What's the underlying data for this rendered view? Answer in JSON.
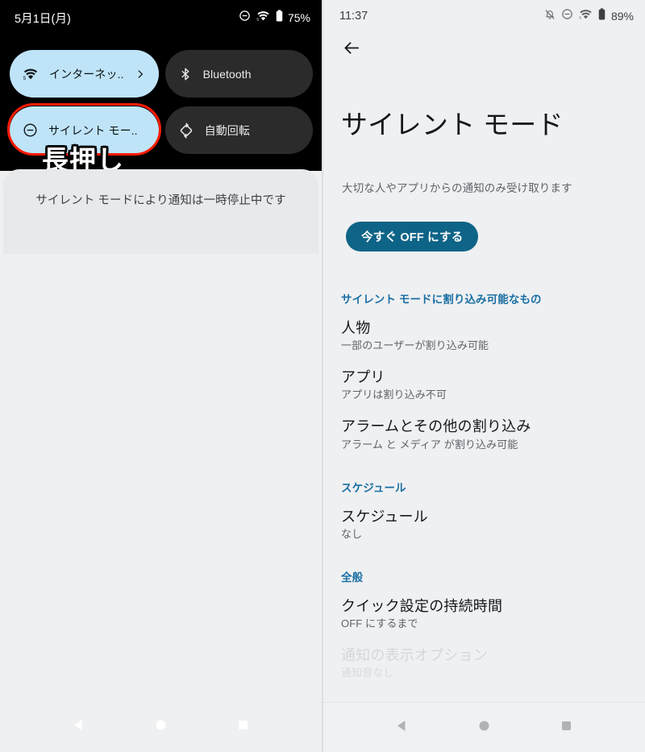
{
  "left_panel": {
    "status_bar": {
      "date": "5月1日(月)",
      "icons": [
        "dnd-circle-minus-icon",
        "wifi-icon",
        "battery-icon"
      ],
      "battery_percent": "75%"
    },
    "quick_tiles": [
      {
        "label": "インターネッ..",
        "icon": "wifi-icon",
        "state": "on",
        "chevron": "chevron-right-icon"
      },
      {
        "label": "Bluetooth",
        "icon": "bluetooth-icon",
        "state": "off",
        "chevron": ""
      },
      {
        "label": "サイレント モー..",
        "icon": "dnd-circle-minus-icon",
        "state": "on",
        "chevron": ""
      },
      {
        "label": "自動回転",
        "icon": "auto-rotate-icon",
        "state": "off",
        "chevron": ""
      }
    ],
    "annotation": {
      "text": "長押し",
      "highlight_color": "#ff1a00"
    },
    "notification_shade": {
      "message": "サイレント モードにより通知は一時停止中です"
    },
    "nav_bar": {
      "back": "back-triangle-icon",
      "home": "home-circle-icon",
      "recents": "recents-square-icon"
    }
  },
  "right_panel": {
    "status_bar": {
      "time": "11:37",
      "icons": [
        "bell-muted-icon",
        "dnd-circle-minus-icon",
        "wifi-icon",
        "battery-icon"
      ],
      "battery_percent": "89%"
    },
    "back_button": "back-arrow-icon",
    "title": "サイレント モード",
    "subtitle": "大切な人やアプリからの通知のみ受け取ります",
    "primary_action": {
      "label": "今すぐ OFF にする",
      "color": "#0e6487"
    },
    "sections": [
      {
        "header": "サイレント モードに割り込み可能なもの",
        "items": [
          {
            "title": "人物",
            "summary": "一部のユーザーが割り込み可能",
            "faded": false
          },
          {
            "title": "アプリ",
            "summary": "アプリは割り込み不可",
            "faded": false
          },
          {
            "title": "アラームとその他の割り込み",
            "summary": "アラーム と メディア が割り込み可能",
            "faded": false
          }
        ]
      },
      {
        "header": "スケジュール",
        "items": [
          {
            "title": "スケジュール",
            "summary": "なし",
            "faded": false
          }
        ]
      },
      {
        "header": "全般",
        "items": [
          {
            "title": "クイック設定の持続時間",
            "summary": "OFF にするまで",
            "faded": false
          },
          {
            "title": "通知の表示オプション",
            "summary": "通知音なし",
            "faded": true
          }
        ]
      }
    ],
    "nav_bar": {
      "back": "back-triangle-icon",
      "home": "home-circle-icon",
      "recents": "recents-square-icon"
    }
  },
  "theme": {
    "tile_on_bg": "#bfe4f8",
    "tile_off_bg": "#2b2b2b",
    "accent_blue": "#1a6fa3",
    "page_bg": "#eff0f2"
  }
}
